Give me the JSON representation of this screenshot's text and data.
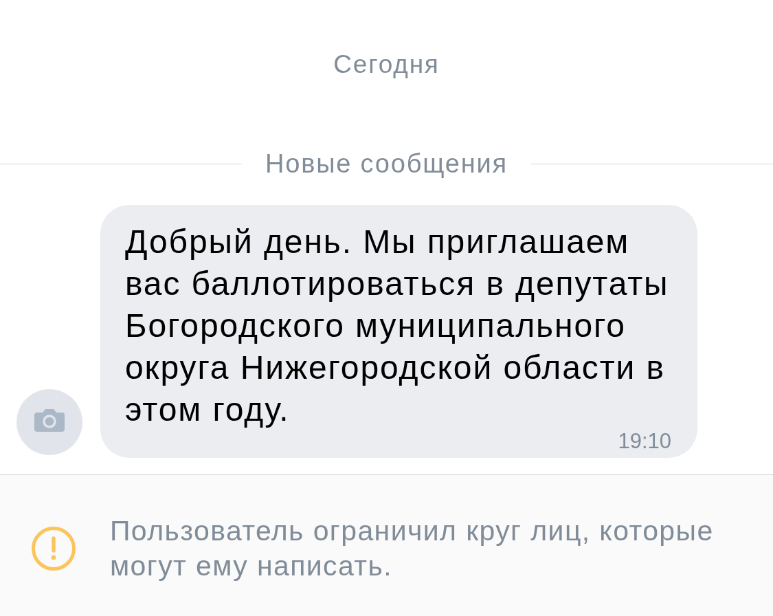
{
  "date_separator": "Сегодня",
  "unread_separator": "Новые сообщения",
  "message": {
    "text": "Добрый день. Мы приглашаем вас баллотироваться в депутаты Богородского муниципального округа Нижегородской области в этом году.",
    "time": "19:10"
  },
  "restriction_notice": {
    "text": "Пользователь ограничил круг лиц, которые могут ему написать."
  }
}
